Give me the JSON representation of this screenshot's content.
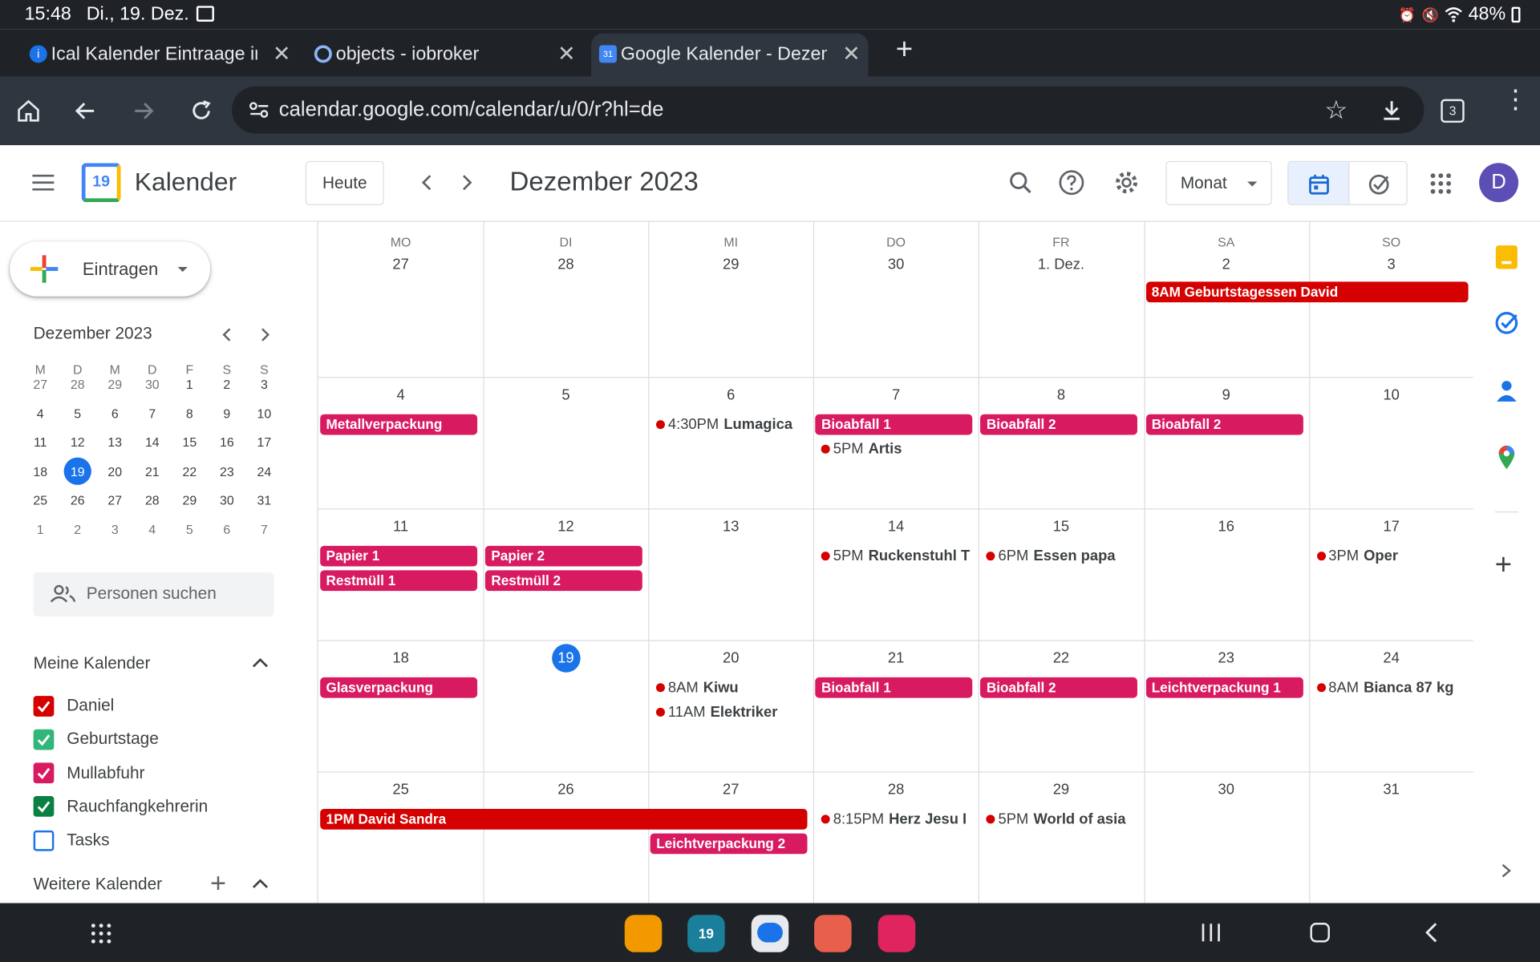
{
  "status": {
    "time": "15:48",
    "date": "Di., 19. Dez.",
    "battery": "48%"
  },
  "tabs": [
    {
      "label": "Ical Kalender Eintraage in",
      "active": false,
      "icon": "info-icon"
    },
    {
      "label": "objects - iobroker",
      "active": false,
      "icon": "gear-icon"
    },
    {
      "label": "Google Kalender - Dezem",
      "active": true,
      "icon": "google-calendar-icon"
    }
  ],
  "browser": {
    "url": "calendar.google.com/calendar/u/0/r?hl=de",
    "tab_count": "3"
  },
  "header": {
    "app_name": "Kalender",
    "logo_num": "19",
    "today": "Heute",
    "title": "Dezember 2023",
    "view": "Monat",
    "avatar": "D"
  },
  "sidebar": {
    "create": "Eintragen",
    "mini_title": "Dezember 2023",
    "mini_days": [
      "M",
      "D",
      "M",
      "D",
      "F",
      "S",
      "S"
    ],
    "mini_weeks": [
      [
        "27",
        "28",
        "29",
        "30",
        "1",
        "2",
        "3"
      ],
      [
        "4",
        "5",
        "6",
        "7",
        "8",
        "9",
        "10"
      ],
      [
        "11",
        "12",
        "13",
        "14",
        "15",
        "16",
        "17"
      ],
      [
        "18",
        "19",
        "20",
        "21",
        "22",
        "23",
        "24"
      ],
      [
        "25",
        "26",
        "27",
        "28",
        "29",
        "30",
        "31"
      ],
      [
        "1",
        "2",
        "3",
        "4",
        "5",
        "6",
        "7"
      ]
    ],
    "people_placeholder": "Personen suchen",
    "my_cal_title": "Meine Kalender",
    "calendars": [
      {
        "name": "Daniel",
        "color": "#d50000",
        "checked": true
      },
      {
        "name": "Geburtstage",
        "color": "#33b679",
        "checked": true
      },
      {
        "name": "Mullabfuhr",
        "color": "#d81b60",
        "checked": true
      },
      {
        "name": "Rauchfangkehrerin",
        "color": "#0b8043",
        "checked": true
      },
      {
        "name": "Tasks",
        "color": "#1a73e8",
        "checked": false
      }
    ],
    "other_cal_title": "Weitere Kalender"
  },
  "calendar": {
    "dow": [
      "MO",
      "DI",
      "MI",
      "DO",
      "FR",
      "SA",
      "SO"
    ],
    "weeks": [
      [
        "27",
        "28",
        "29",
        "30",
        "1. Dez.",
        "2",
        "3"
      ],
      [
        "4",
        "5",
        "6",
        "7",
        "8",
        "9",
        "10"
      ],
      [
        "11",
        "12",
        "13",
        "14",
        "15",
        "16",
        "17"
      ],
      [
        "18",
        "19",
        "20",
        "21",
        "22",
        "23",
        "24"
      ],
      [
        "25",
        "26",
        "27",
        "28",
        "29",
        "30",
        "31"
      ]
    ],
    "today": "19",
    "colors": {
      "daniel": "#d50000",
      "mull": "#d81b60",
      "today": "#1a73e8"
    },
    "chips": [
      {
        "week": 0,
        "col": 5,
        "span": 2,
        "row": 0,
        "text": "8AM Geburtstagessen David",
        "color": "#d50000"
      },
      {
        "week": 1,
        "col": 0,
        "span": 1,
        "row": 0,
        "text": "Metallverpackung",
        "color": "#d81b60"
      },
      {
        "week": 1,
        "col": 3,
        "span": 1,
        "row": 0,
        "text": "Bioabfall 1",
        "color": "#d81b60"
      },
      {
        "week": 1,
        "col": 4,
        "span": 1,
        "row": 0,
        "text": "Bioabfall 2",
        "color": "#d81b60"
      },
      {
        "week": 1,
        "col": 5,
        "span": 1,
        "row": 0,
        "text": "Bioabfall 2",
        "color": "#d81b60"
      },
      {
        "week": 2,
        "col": 0,
        "span": 1,
        "row": 0,
        "text": "Papier 1",
        "color": "#d81b60"
      },
      {
        "week": 2,
        "col": 0,
        "span": 1,
        "row": 1,
        "text": "Restmüll 1",
        "color": "#d81b60"
      },
      {
        "week": 2,
        "col": 1,
        "span": 1,
        "row": 0,
        "text": "Papier 2",
        "color": "#d81b60"
      },
      {
        "week": 2,
        "col": 1,
        "span": 1,
        "row": 1,
        "text": "Restmüll 2",
        "color": "#d81b60"
      },
      {
        "week": 3,
        "col": 0,
        "span": 1,
        "row": 0,
        "text": "Glasverpackung",
        "color": "#d81b60"
      },
      {
        "week": 3,
        "col": 3,
        "span": 1,
        "row": 0,
        "text": "Bioabfall 1",
        "color": "#d81b60"
      },
      {
        "week": 3,
        "col": 4,
        "span": 1,
        "row": 0,
        "text": "Bioabfall 2",
        "color": "#d81b60"
      },
      {
        "week": 3,
        "col": 5,
        "span": 1,
        "row": 0,
        "text": "Leichtverpackung 1",
        "color": "#d81b60"
      },
      {
        "week": 4,
        "col": 0,
        "span": 3,
        "row": 0,
        "text": "1PM David Sandra",
        "color": "#d50000"
      },
      {
        "week": 4,
        "col": 2,
        "span": 1,
        "row": 1,
        "text": "Leichtverpackung 2",
        "color": "#d81b60"
      }
    ],
    "timed": [
      {
        "week": 1,
        "col": 2,
        "row": 0,
        "time": "4:30PM",
        "name": "Lumagica"
      },
      {
        "week": 1,
        "col": 3,
        "row": 1,
        "time": "5PM",
        "name": "Artis"
      },
      {
        "week": 2,
        "col": 3,
        "row": 0,
        "time": "5PM",
        "name": "Ruckenstuhl T"
      },
      {
        "week": 2,
        "col": 4,
        "row": 0,
        "time": "6PM",
        "name": "Essen papa"
      },
      {
        "week": 2,
        "col": 6,
        "row": 0,
        "time": "3PM",
        "name": "Oper"
      },
      {
        "week": 3,
        "col": 2,
        "row": 0,
        "time": "8AM",
        "name": "Kiwu"
      },
      {
        "week": 3,
        "col": 2,
        "row": 1,
        "time": "11AM",
        "name": "Elektriker"
      },
      {
        "week": 3,
        "col": 6,
        "row": 0,
        "time": "8AM",
        "name": "Bianca 87 kg"
      },
      {
        "week": 4,
        "col": 3,
        "row": 0,
        "time": "8:15PM",
        "name": "Herz Jesu I"
      },
      {
        "week": 4,
        "col": 4,
        "row": 0,
        "time": "5PM",
        "name": "World of asia"
      }
    ]
  },
  "dock_icons": [
    "files-icon",
    "calendar-app-icon",
    "messages-icon",
    "contacts-icon",
    "camera-icon"
  ]
}
